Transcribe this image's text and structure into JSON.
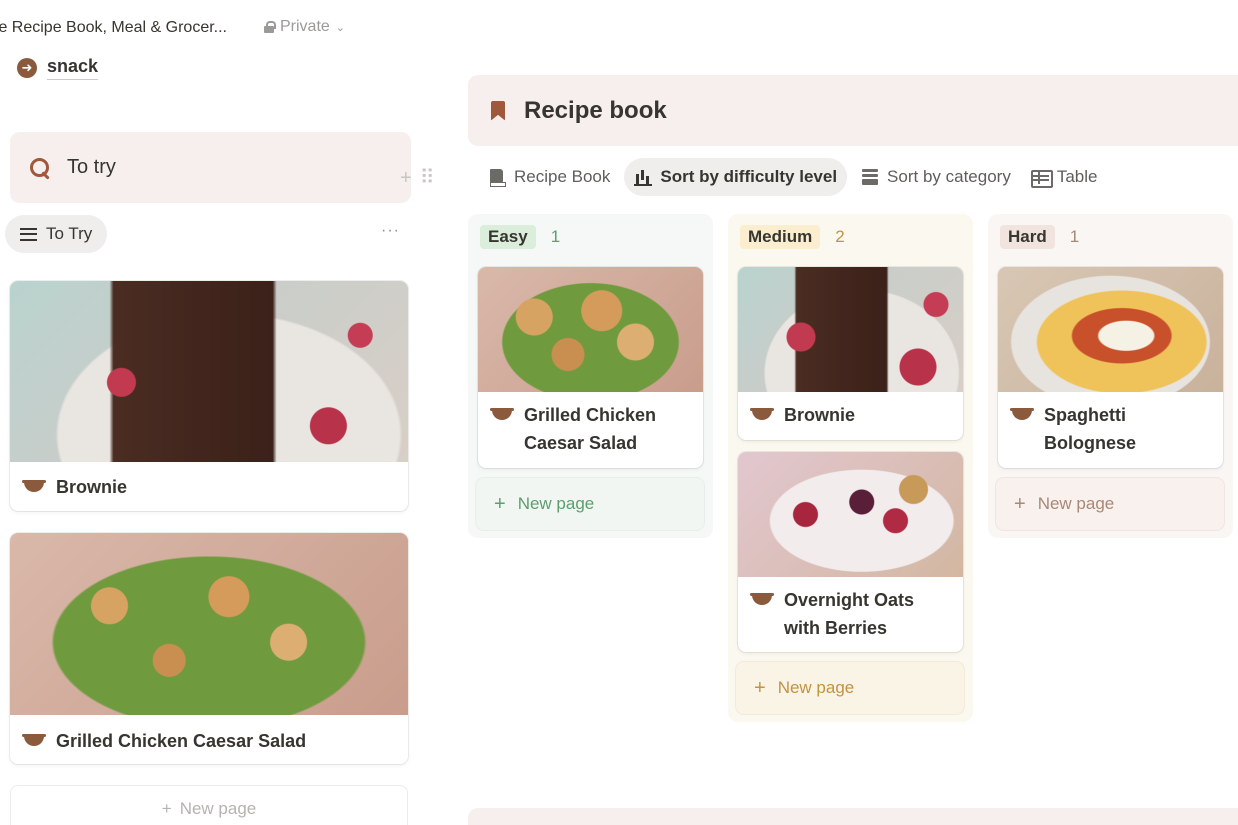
{
  "topbar": {
    "crumb": "te Recipe Book, Meal & Grocer...",
    "privacy": "Private"
  },
  "snack": {
    "label": "snack"
  },
  "left": {
    "callout_text": "To try",
    "view_label": "To Try",
    "more": "···",
    "cards": [
      {
        "title": "Brownie"
      },
      {
        "title": "Grilled Chicken Caesar Salad"
      }
    ],
    "new_page": "New page"
  },
  "recipe_book": {
    "title": "Recipe book",
    "tabs": [
      {
        "label": "Recipe Book",
        "icon": "book-icon"
      },
      {
        "label": "Sort by difficulty level",
        "icon": "bar-chart-icon",
        "active": true
      },
      {
        "label": "Sort by category",
        "icon": "stack-icon"
      },
      {
        "label": "Table",
        "icon": "table-icon"
      }
    ],
    "columns": [
      {
        "label": "Easy",
        "count": "1",
        "cards": [
          {
            "title": "Grilled Chicken Caesar Salad"
          }
        ],
        "new_page": "New page"
      },
      {
        "label": "Medium",
        "count": "2",
        "cards": [
          {
            "title": "Brownie"
          },
          {
            "title": "Overnight Oats with Berries"
          }
        ],
        "new_page": "New page"
      },
      {
        "label": "Hard",
        "count": "1",
        "cards": [
          {
            "title": "Spaghetti Bolognese"
          }
        ],
        "new_page": "New page"
      }
    ]
  },
  "colors": {
    "accent_brown": "#a0583d",
    "callout_bg": "#f6efee",
    "easy_badge": "#dbeddb",
    "medium_badge": "#fbeecf",
    "hard_badge": "#f1e4df"
  }
}
